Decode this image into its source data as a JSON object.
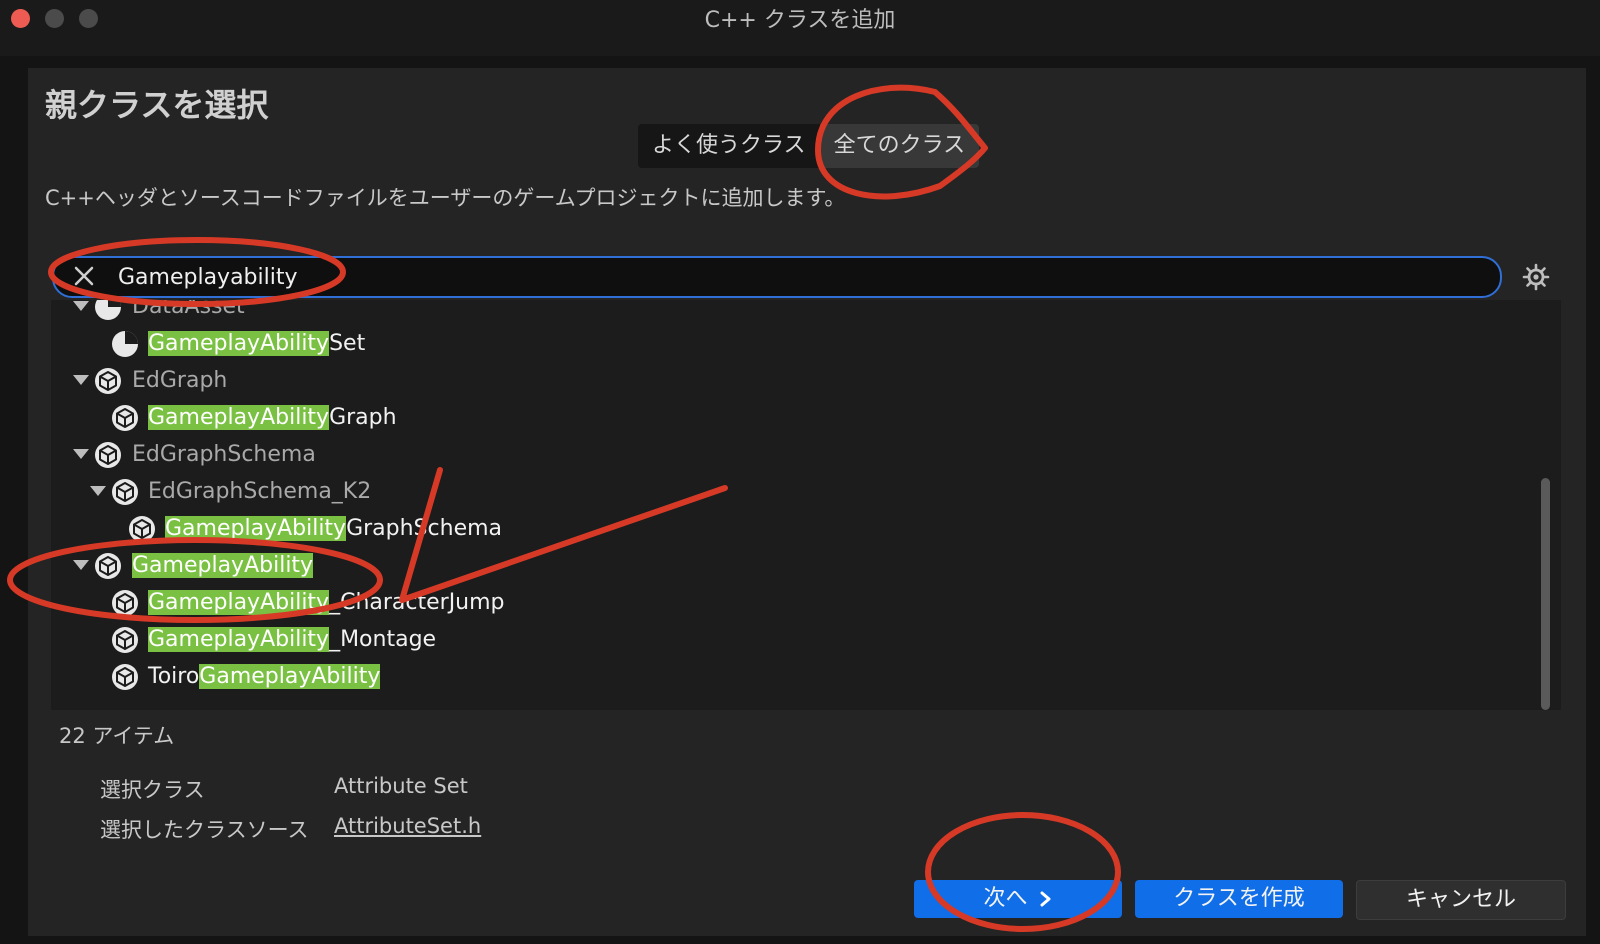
{
  "window": {
    "title": "C++ クラスを追加"
  },
  "heading": "親クラスを選択",
  "tabs": [
    {
      "label": "よく使うクラス"
    },
    {
      "label": "全てのクラス"
    }
  ],
  "description": "C++ヘッダとソースコードファイルをユーザーのゲームプロジェクトに追加します。",
  "search": {
    "value": "Gameplayability"
  },
  "tree": [
    {
      "pre": "",
      "hl": "",
      "post": "DataAsset",
      "type": "parent"
    },
    {
      "pre": "",
      "hl": "GameplayAbility",
      "post": "Set",
      "type": "leaf"
    },
    {
      "pre": "",
      "hl": "",
      "post": "EdGraph",
      "type": "parent"
    },
    {
      "pre": "",
      "hl": "GameplayAbility",
      "post": "Graph",
      "type": "leaf"
    },
    {
      "pre": "",
      "hl": "",
      "post": "EdGraphSchema",
      "type": "parent"
    },
    {
      "pre": "",
      "hl": "",
      "post": "EdGraphSchema_K2",
      "type": "parent"
    },
    {
      "pre": "",
      "hl": "GameplayAbility",
      "post": "GraphSchema",
      "type": "leaf"
    },
    {
      "pre": "",
      "hl": "GameplayAbility",
      "post": "",
      "type": "parent-match"
    },
    {
      "pre": "",
      "hl": "GameplayAbility",
      "post": "_CharacterJump",
      "type": "leaf"
    },
    {
      "pre": "",
      "hl": "GameplayAbility",
      "post": "_Montage",
      "type": "leaf"
    },
    {
      "pre": "Toiro",
      "hl": "GameplayAbility",
      "post": "",
      "type": "leaf"
    }
  ],
  "item_count": "22 アイテム",
  "details": {
    "selected_class_label": "選択クラス",
    "selected_class_value": "Attribute Set",
    "selected_source_label": "選択したクラスソース",
    "selected_source_value": "AttributeSet.h"
  },
  "buttons": {
    "next": "次へ",
    "create": "クラスを作成",
    "cancel": "キャンセル"
  },
  "colors": {
    "accent": "#0f6ee8",
    "highlight": "#7ac143",
    "annotation": "#d63a26"
  }
}
